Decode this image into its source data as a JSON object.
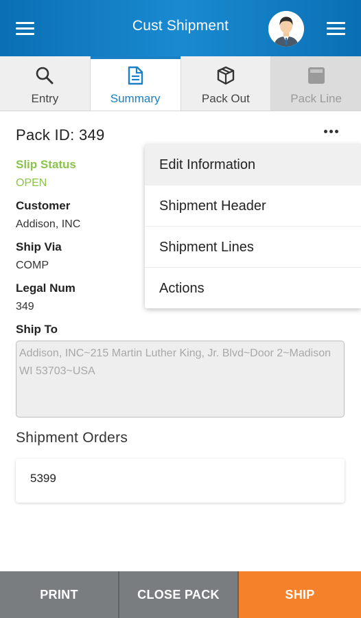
{
  "header": {
    "title": "Cust Shipment",
    "menu_icon": "hamburger-icon",
    "avatar_icon": "user-avatar"
  },
  "tabs": [
    {
      "label": "Entry",
      "icon": "search-icon",
      "state": "normal"
    },
    {
      "label": "Summary",
      "icon": "document-icon",
      "state": "active"
    },
    {
      "label": "Pack Out",
      "icon": "package-icon",
      "state": "normal"
    },
    {
      "label": "Pack Line",
      "icon": "pack-line-icon",
      "state": "disabled"
    }
  ],
  "pack": {
    "id_label": "Pack ID: 349",
    "slip_status_label": "Slip Status",
    "slip_status_value": "OPEN",
    "customer_label": "Customer",
    "customer_value": "Addison, INC",
    "ship_via_label": "Ship Via",
    "ship_via_value": "COMP",
    "legal_num_label": "Legal Num",
    "legal_num_value": "349",
    "ship_to_label": "Ship To",
    "ship_to_value": "Addison, INC~215 Martin Luther King, Jr. Blvd~Door 2~Madison WI 53703~USA"
  },
  "orders": {
    "title": "Shipment Orders",
    "items": [
      "5399"
    ]
  },
  "menu": {
    "items": [
      "Edit Information",
      "Shipment Header",
      "Shipment Lines",
      "Actions"
    ]
  },
  "buttons": {
    "print": "PRINT",
    "close_pack": "CLOSE PACK",
    "ship": "SHIP"
  },
  "colors": {
    "header": "#1a7fc4",
    "accent": "#1a7fc4",
    "status": "#8bc34a",
    "ship": "#f5822a",
    "secondary_button": "#7a7d80"
  }
}
